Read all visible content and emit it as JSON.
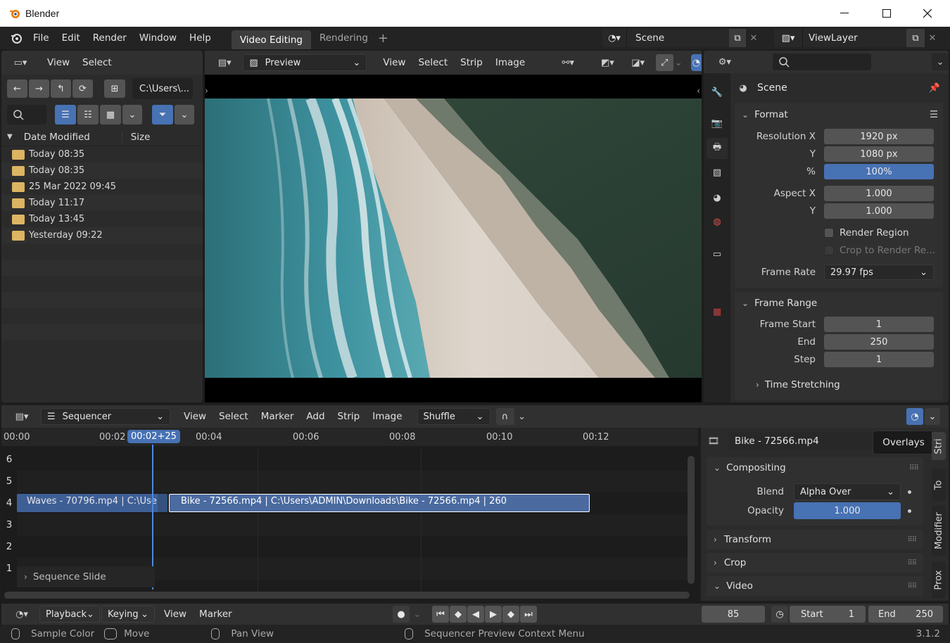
{
  "window": {
    "title": "Blender"
  },
  "topbar": {
    "menus": [
      "File",
      "Edit",
      "Render",
      "Window",
      "Help"
    ],
    "workspaces": [
      "Video Editing",
      "Rendering"
    ],
    "scene": "Scene",
    "view_layer": "ViewLayer"
  },
  "filebrowser": {
    "menus": [
      "View",
      "Select"
    ],
    "path": "C:\\Users\\...",
    "columns": {
      "date": "Date Modified",
      "size": "Size"
    },
    "rows": [
      "Today 08:35",
      "Today 08:35",
      "25 Mar 2022 09:45",
      "Today 11:17",
      "Today 13:45",
      "Yesterday 09:22"
    ]
  },
  "preview": {
    "mode": "Preview",
    "menus": [
      "View",
      "Select",
      "Strip",
      "Image"
    ]
  },
  "properties": {
    "context": "Scene",
    "format": {
      "title": "Format",
      "res_x_label": "Resolution X",
      "res_x": "1920 px",
      "res_y_label": "Y",
      "res_y": "1080 px",
      "pct_label": "%",
      "pct": "100%",
      "aspect_x_label": "Aspect X",
      "aspect_x": "1.000",
      "aspect_y_label": "Y",
      "aspect_y": "1.000",
      "render_region": "Render Region",
      "crop": "Crop to Render Re...",
      "frame_rate_label": "Frame Rate",
      "frame_rate": "29.97 fps"
    },
    "frame_range": {
      "title": "Frame Range",
      "start_label": "Frame Start",
      "start": "1",
      "end_label": "End",
      "end": "250",
      "step_label": "Step",
      "step": "1",
      "time_stretching": "Time Stretching"
    }
  },
  "sequencer": {
    "mode": "Sequencer",
    "menus": [
      "View",
      "Select",
      "Marker",
      "Add",
      "Strip",
      "Image"
    ],
    "overlap_mode": "Shuffle",
    "ruler": [
      "00:00",
      "00:02",
      "00:04",
      "00:06",
      "00:08",
      "00:10",
      "00:12"
    ],
    "current_time": "00:02+25",
    "channels": [
      "6",
      "5",
      "4",
      "3",
      "2",
      "1"
    ],
    "strips": {
      "waves": "Waves - 70796.mp4 | C:\\Use",
      "bike": "Bike - 72566.mp4 | C:\\Users\\ADMIN\\Downloads\\Bike - 72566.mp4 | 260"
    },
    "operator_panel": "Sequence Slide"
  },
  "strip_props": {
    "name": "Bike - 72566.mp4",
    "tooltip": "Overlays",
    "compositing": "Compositing",
    "blend_label": "Blend",
    "blend": "Alpha Over",
    "opacity_label": "Opacity",
    "opacity": "1.000",
    "transform": "Transform",
    "crop": "Crop",
    "video": "Video",
    "tabs": [
      "Stri",
      "To",
      "Modifier",
      "Prox"
    ]
  },
  "timeline": {
    "menus": [
      "Playback",
      "Keying",
      "View",
      "Marker"
    ],
    "current_frame": "85",
    "start_label": "Start",
    "start": "1",
    "end_label": "End",
    "end": "250"
  },
  "statusbar": {
    "items": [
      "Sample Color",
      "Move",
      "Pan View",
      "Sequencer Preview Context Menu"
    ],
    "version": "3.1.2"
  }
}
